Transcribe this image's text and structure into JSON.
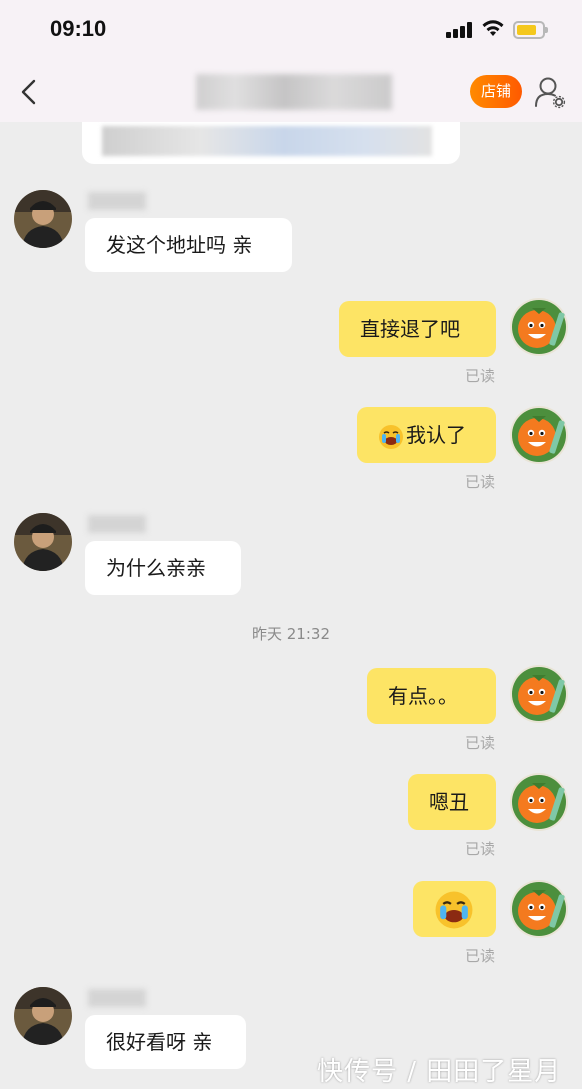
{
  "status_bar": {
    "time": "09:10"
  },
  "header": {
    "shop_label": "店铺"
  },
  "messages": {
    "m1": "发这个地址吗 亲",
    "m2": "直接退了吧",
    "m3": "我认了",
    "m4": "为什么亲亲",
    "m6": "有点。。",
    "m7": "嗯丑",
    "m9": "很好看呀 亲"
  },
  "read_label": "已读",
  "timestamp": "昨天 21:32",
  "watermark": "快传号 / 田田了星月",
  "colors": {
    "accent": "#ff6a00",
    "my_bubble": "#fde465",
    "background": "#ededed"
  }
}
